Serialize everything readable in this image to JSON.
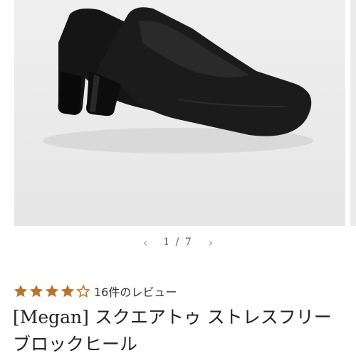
{
  "gallery": {
    "image_alt": "black square-toe block heel pumps",
    "current_page": "1",
    "separator": "/",
    "total_pages": "7",
    "prev_icon": "chevron-left-icon",
    "next_icon": "chevron-right-icon"
  },
  "rating": {
    "stars": 4,
    "max_stars": 5,
    "star_color": "#b8742a",
    "review_text": "16件のレビュー"
  },
  "product": {
    "title": "[Megan] スクエアトゥ ストレスフリー ブロックヒール"
  }
}
